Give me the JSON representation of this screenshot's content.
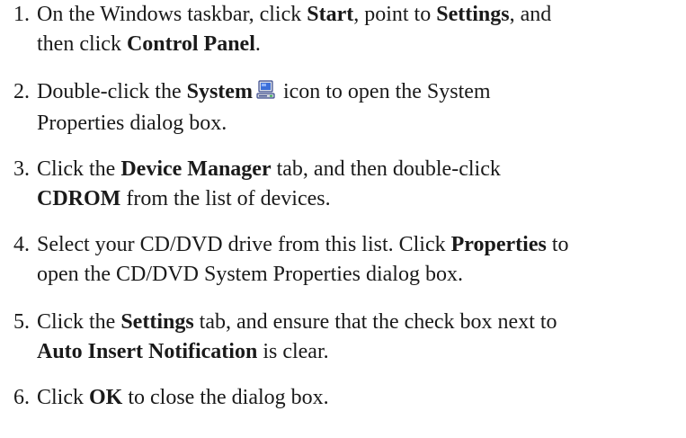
{
  "steps": [
    {
      "number": "1.",
      "line1_a": "On the Windows taskbar, click ",
      "line1_b": "Start",
      "line1_c": ", point to ",
      "line1_d": "Settings",
      "line1_e": ", and",
      "line2_a": "then click ",
      "line2_b": "Control Panel",
      "line2_c": "."
    },
    {
      "number": "2.",
      "line1_a": "Double-click the ",
      "line1_b": "System",
      "line1_c": " icon to open the System",
      "line2_a": "Properties dialog box.",
      "icon": "system-computer-icon"
    },
    {
      "number": "3.",
      "line1_a": "Click the ",
      "line1_b": "Device Manager",
      "line1_c": " tab, and then double-click",
      "line2_a": "CDROM",
      "line2_b": " from the list of devices."
    },
    {
      "number": "4.",
      "line1_a": "Select your CD/DVD drive from this list. Click ",
      "line1_b": "Properties",
      "line1_c": " to",
      "line2_a": "open the CD/DVD System Properties dialog box."
    },
    {
      "number": "5.",
      "line1_a": "Click the ",
      "line1_b": "Settings",
      "line1_c": " tab, and ensure that the check box next to",
      "line2_a": "Auto Insert Notification",
      "line2_b": " is clear."
    },
    {
      "number": "6.",
      "line1_a": "Click ",
      "line1_b": "OK",
      "line1_c": " to close the dialog box."
    }
  ]
}
